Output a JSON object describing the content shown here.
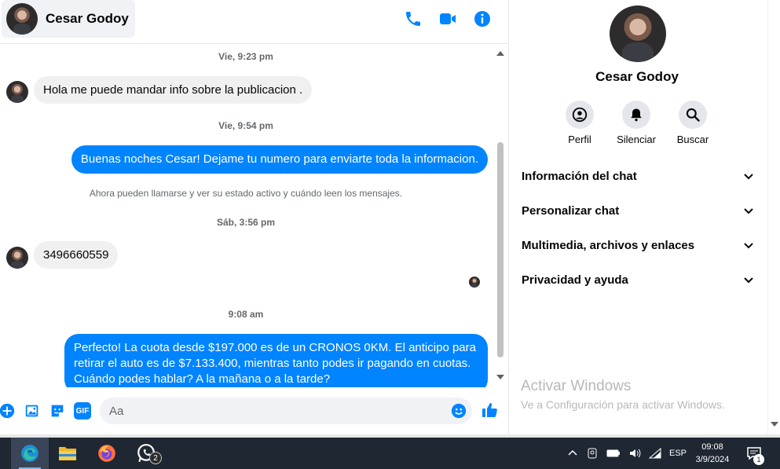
{
  "header": {
    "contact_name": "Cesar Godoy",
    "icons": [
      "phone-icon",
      "video-icon",
      "info-icon"
    ]
  },
  "messages": [
    {
      "type": "timestamp",
      "text": "Vie, 9:23 pm"
    },
    {
      "type": "incoming",
      "text": "Hola me puede mandar info sobre la publicacion ."
    },
    {
      "type": "timestamp",
      "text": "Vie, 9:54 pm"
    },
    {
      "type": "outgoing",
      "text": "Buenas noches Cesar! Dejame tu numero para enviarte toda la informacion."
    },
    {
      "type": "notice",
      "text": "Ahora pueden llamarse y ver su estado activo y cuándo leen los mensajes."
    },
    {
      "type": "timestamp",
      "text": "Sáb, 3:56 pm"
    },
    {
      "type": "incoming",
      "text": "3496660559"
    },
    {
      "type": "timestamp",
      "text": "9:08 am"
    },
    {
      "type": "outgoing",
      "text": "Perfecto! La cuota desde $197.000 es de un CRONOS 0KM. El anticipo para retirar el auto es de $7.133.400, mientras tanto podes ir pagando en cuotas. Cuándo podes hablar? A la mañana o a la tarde?"
    }
  ],
  "composer": {
    "placeholder": "Aa",
    "icons": [
      "plus-icon",
      "image-icon",
      "sticker-icon",
      "gif-icon",
      "emoji-icon",
      "like-icon"
    ],
    "gif_label": "GIF"
  },
  "panel": {
    "name": "Cesar Godoy",
    "actions": [
      {
        "label": "Perfil",
        "icon": "profile-icon"
      },
      {
        "label": "Silenciar",
        "icon": "bell-icon"
      },
      {
        "label": "Buscar",
        "icon": "search-icon"
      }
    ],
    "sections": [
      {
        "label": "Información del chat"
      },
      {
        "label": "Personalizar chat"
      },
      {
        "label": "Multimedia, archivos y enlaces"
      },
      {
        "label": "Privacidad y ayuda"
      }
    ]
  },
  "watermark": {
    "title": "Activar Windows",
    "subtitle": "Ve a Configuración para activar Windows."
  },
  "taskbar": {
    "apps": [
      "edge-icon",
      "file-explorer-icon",
      "firefox-icon",
      "whatsapp-icon"
    ],
    "whatsapp_badge": "2",
    "language": "ESP",
    "time": "09:08",
    "date": "3/9/2024",
    "notification_count": "1"
  },
  "colors": {
    "accent": "#0084ff",
    "incoming_bubble": "#f0f0f0",
    "taskbar": "#1f2733"
  }
}
